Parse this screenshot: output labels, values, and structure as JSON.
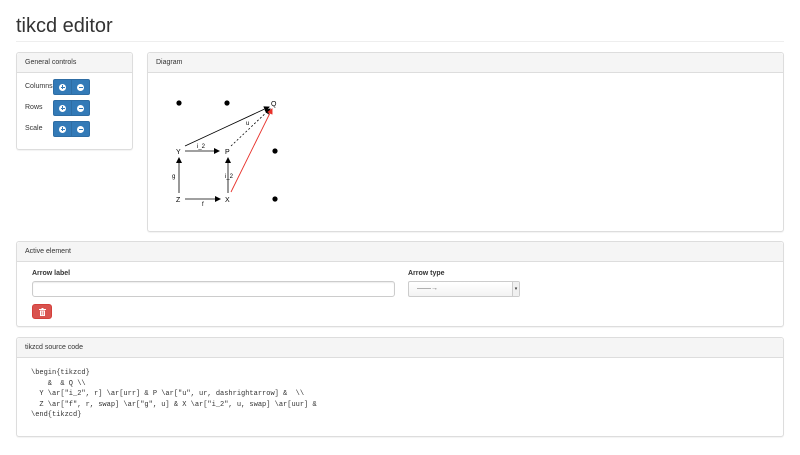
{
  "app": {
    "title": "tikcd editor"
  },
  "general_controls": {
    "heading": "General controls",
    "rows": [
      {
        "label": "Columns",
        "plus_icon": "plus-circle-icon",
        "minus_icon": "minus-circle-icon"
      },
      {
        "label": "Rows",
        "plus_icon": "plus-circle-icon",
        "minus_icon": "minus-circle-icon"
      },
      {
        "label": "Scale",
        "plus_icon": "plus-circle-icon",
        "minus_icon": "minus-circle-icon"
      }
    ]
  },
  "diagram": {
    "heading": "Diagram",
    "nodes": {
      "Q": "Q",
      "Y": "Y",
      "P": "P",
      "Z": "Z",
      "X": "X"
    },
    "edge_labels": {
      "YP": "i_2",
      "PQ": "u",
      "XP": "i_2",
      "ZY": "g",
      "ZX": "f"
    },
    "active_edge_color": "#e8312a"
  },
  "active_element": {
    "heading": "Active element",
    "arrow_label": {
      "label": "Arrow label",
      "value": "",
      "placeholder": ""
    },
    "arrow_type": {
      "label": "Arrow type",
      "selected": "——→"
    },
    "delete_icon": "trash-icon",
    "delete_color": "#d9534f"
  },
  "source": {
    "heading": "tikzcd source code",
    "code": "\\begin{tikzcd}\n    &  & Q \\\\\n  Y \\ar[\"i_2\", r] \\ar[urr] & P \\ar[\"u\", ur, dashrightarrow] &  \\\\\n  Z \\ar[\"f\", r, swap] \\ar[\"g\", u] & X \\ar[\"i_2\", u, swap] \\ar[uur] &\n\\end{tikzcd}"
  },
  "colors": {
    "primary": "#337ab7",
    "danger": "#d9534f",
    "panel_heading_bg": "#f5f5f5"
  }
}
